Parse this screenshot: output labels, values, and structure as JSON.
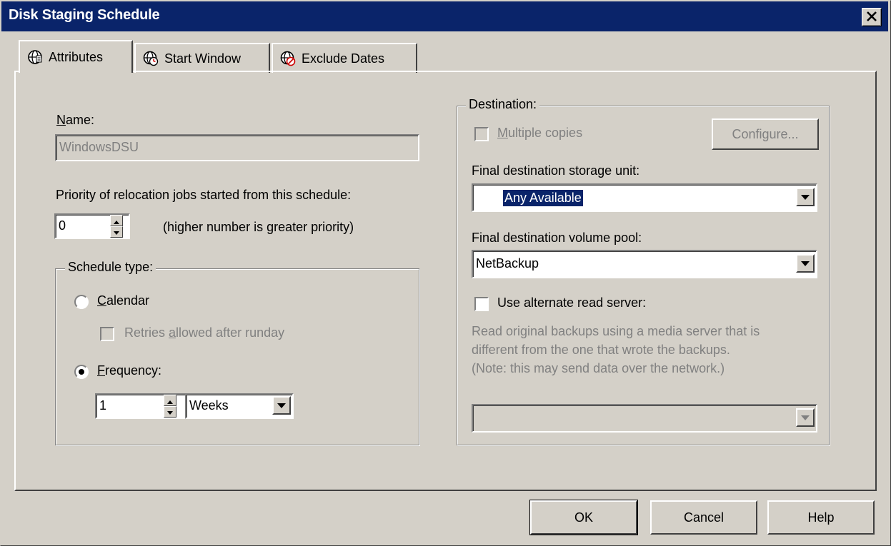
{
  "window": {
    "title": "Disk Staging Schedule",
    "close_glyph": "✕"
  },
  "tabs": [
    {
      "label": "Attributes",
      "icon": "globe-icon"
    },
    {
      "label": "Start Window",
      "icon": "globe-clock-icon"
    },
    {
      "label": "Exclude Dates",
      "icon": "globe-exclude-icon"
    }
  ],
  "attributes": {
    "name_label": "Name:",
    "name_value": "WindowsDSU",
    "priority_label": "Priority of relocation jobs started from this schedule:",
    "priority_value": "0",
    "priority_hint": "(higher number is greater priority)",
    "schedule_type": {
      "label": "Schedule type:",
      "calendar_label": "Calendar",
      "retries_label": "Retries allowed after runday",
      "frequency_label": "Frequency:",
      "frequency_value": "1",
      "frequency_unit": "Weeks",
      "selected": "Frequency"
    },
    "destination": {
      "label": "Destination:",
      "multiple_copies_label": "Multiple copies",
      "configure_label": "Configure...",
      "storage_unit_label": "Final destination storage unit:",
      "storage_unit_value": "Any Available",
      "volume_pool_label": "Final destination volume pool:",
      "volume_pool_value": "NetBackup",
      "alt_read_label": "Use alternate read server:",
      "alt_read_desc_1": "Read original backups using a media server that is",
      "alt_read_desc_2": "different from the one that wrote the backups.",
      "alt_read_desc_3": "(Note: this may send data over the network.)",
      "alt_read_server_value": ""
    }
  },
  "buttons": {
    "ok": "OK",
    "cancel": "Cancel",
    "help": "Help"
  },
  "colors": {
    "titlebar": "#0a246a",
    "face": "#d4d0c8",
    "selection": "#0a246a"
  }
}
